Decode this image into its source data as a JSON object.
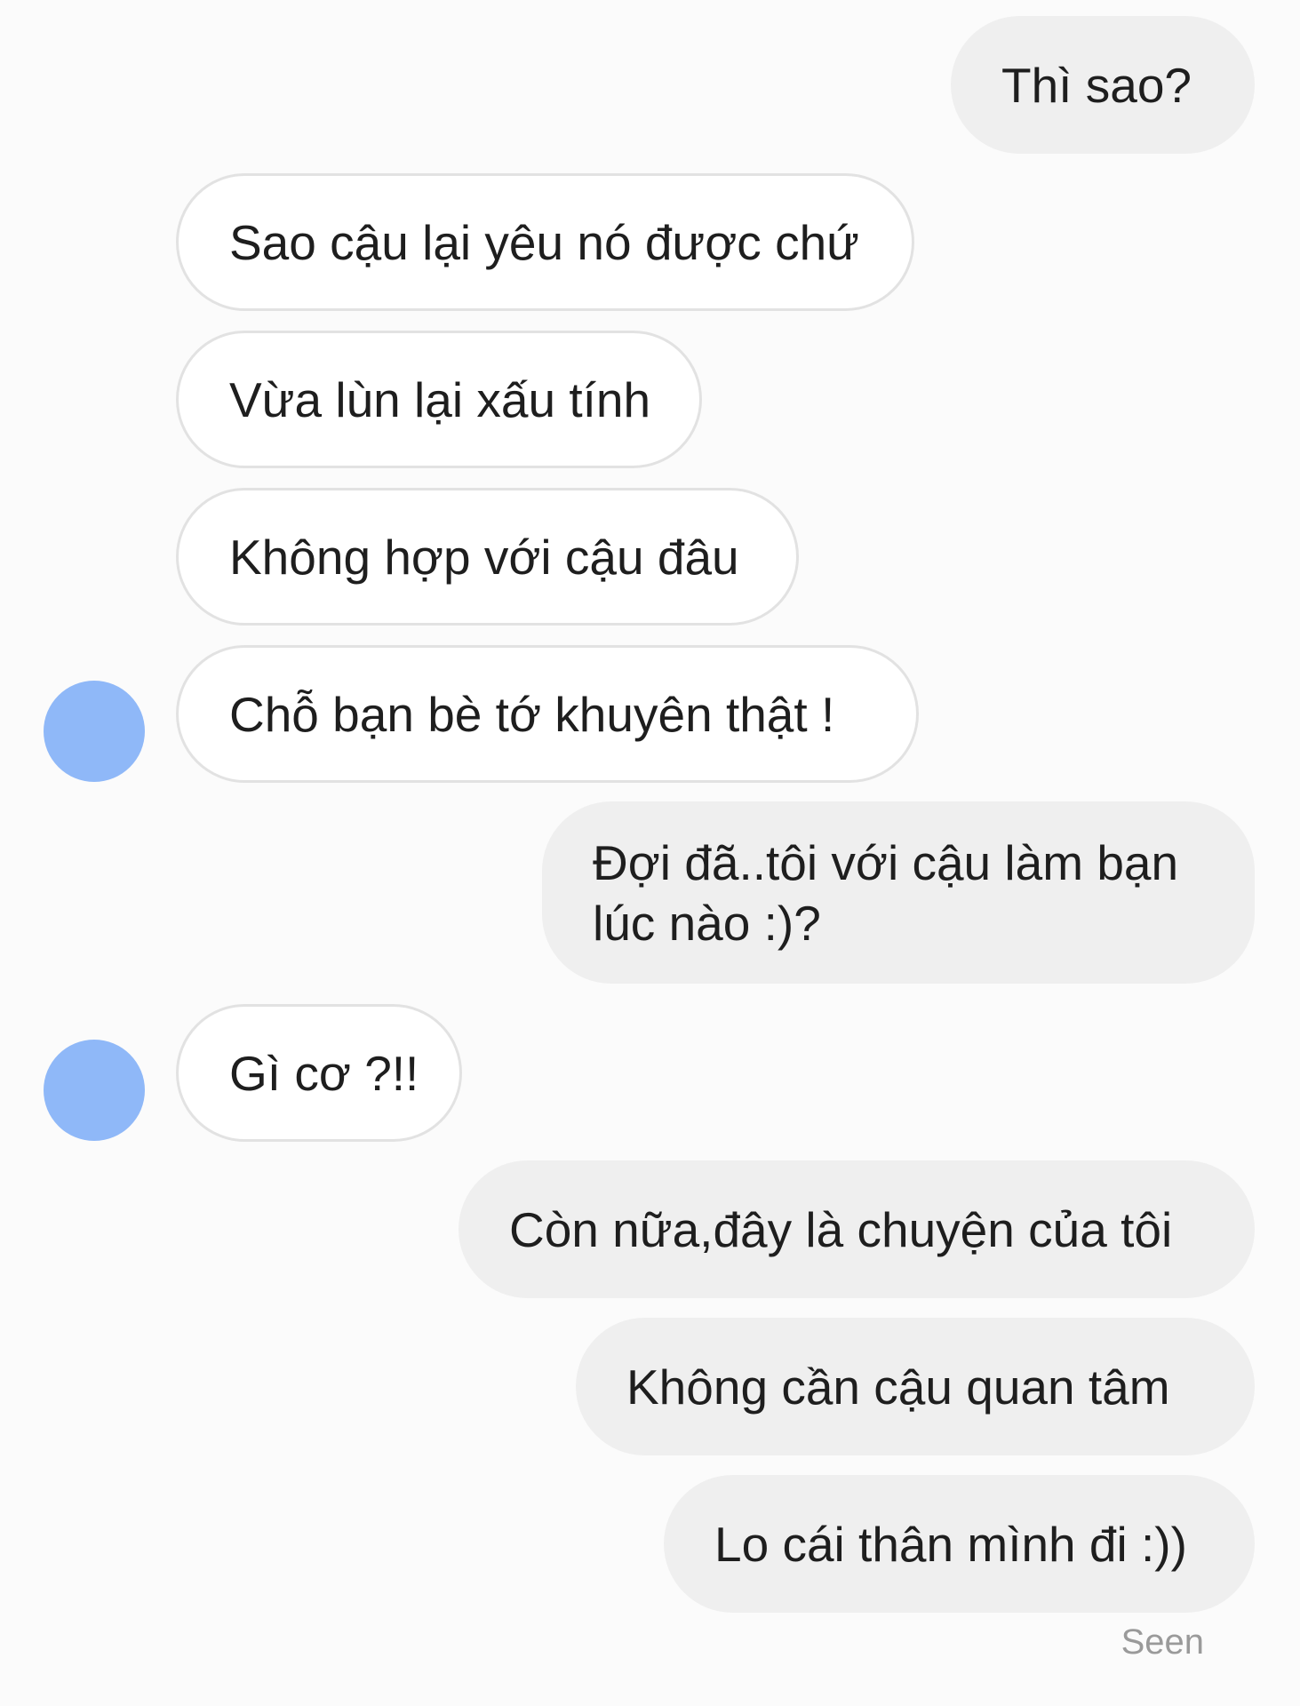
{
  "avatar_color": "#8fb8f8",
  "messages": [
    {
      "side": "out",
      "text": "Thì sao?"
    },
    {
      "side": "in",
      "text": "Sao cậu lại yêu nó được chứ"
    },
    {
      "side": "in",
      "text": "Vừa lùn lại xấu tính"
    },
    {
      "side": "in",
      "text": "Không hợp với cậu đâu"
    },
    {
      "side": "in",
      "text": "Chỗ bạn bè tớ khuyên thật !",
      "avatar": true
    },
    {
      "side": "out",
      "text": "Đợi đã..tôi với cậu làm bạn lúc nào :)?"
    },
    {
      "side": "in",
      "text": "Gì cơ ?!!",
      "avatar": true
    },
    {
      "side": "out",
      "text": "Còn nữa,đây là chuyện của tôi"
    },
    {
      "side": "out",
      "text": "Không cần cậu quan tâm"
    },
    {
      "side": "out",
      "text": "Lo cái thân mình đi :))"
    }
  ],
  "status": "Seen"
}
